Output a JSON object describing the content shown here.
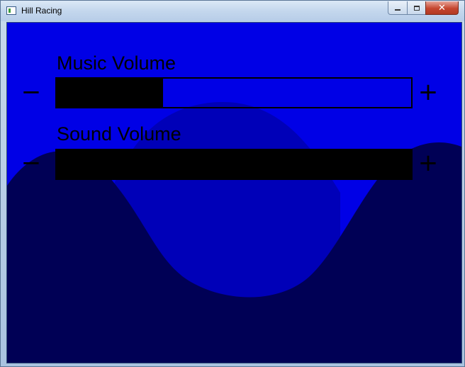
{
  "window": {
    "title": "Hill Racing",
    "close_glyph": "✕"
  },
  "colors": {
    "sky": "#0000e6",
    "hill_back": "#0000b8",
    "hill_front": "#000055",
    "bar_fill": "#000000"
  },
  "settings": {
    "music": {
      "label": "Music Volume",
      "decrease_glyph": "−",
      "increase_glyph": "+",
      "level": 0.3
    },
    "sound": {
      "label": "Sound Volume",
      "decrease_glyph": "−",
      "increase_glyph": "+",
      "level": 1.0
    }
  }
}
